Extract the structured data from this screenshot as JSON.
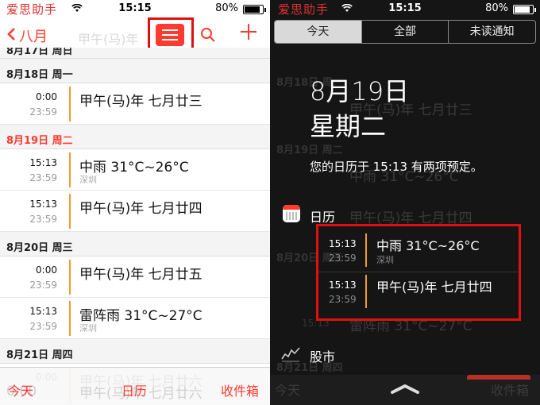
{
  "watermark": "爱思助手",
  "status": {
    "time": "15:15",
    "battery": "80%"
  },
  "left": {
    "nav": {
      "back_label": "八月",
      "ghost_title": "甲午(马)年"
    },
    "partial_top_header": "8月17日 周日",
    "sections": [
      {
        "header": "8月18日 周一",
        "highlight": false,
        "events": [
          {
            "start": "0:00",
            "end": "23:59",
            "title": "甲午(马)年 七月廿三",
            "sub": ""
          }
        ]
      },
      {
        "header": "8月19日 周二",
        "highlight": true,
        "events": [
          {
            "start": "15:13",
            "end": "23:59",
            "title": "中雨 31°C~26°C",
            "sub": "深圳"
          },
          {
            "start": "15:13",
            "end": "23:59",
            "title": "甲午(马)年 七月廿四",
            "sub": ""
          }
        ]
      },
      {
        "header": "8月20日 周三",
        "highlight": false,
        "events": [
          {
            "start": "0:00",
            "end": "23:59",
            "title": "甲午(马)年 七月廿五",
            "sub": ""
          },
          {
            "start": "15:13",
            "end": "23:59",
            "title": "雷阵雨 31°C~27°C",
            "sub": "深圳"
          }
        ]
      },
      {
        "header": "8月21日 周四",
        "highlight": false,
        "events": [
          {
            "start": "0:00",
            "end": "",
            "title": "甲午(马)年 七月廿六",
            "sub": ""
          }
        ]
      }
    ],
    "tabbar": {
      "today": "今天",
      "calendars": "日历",
      "inbox": "收件箱"
    }
  },
  "right": {
    "segments": [
      "今天",
      "全部",
      "未读通知"
    ],
    "active_segment": 0,
    "date": "8月19日",
    "weekday": "星期二",
    "summary": "您的日历于 15:13 有两项预定。",
    "calendar_label": "日历",
    "events": [
      {
        "start": "15:13",
        "end": "23:59",
        "title": "中雨 31°C~26°C",
        "sub": "深圳"
      },
      {
        "start": "15:13",
        "end": "23:59",
        "title": "甲午(马)年 七月廿四",
        "sub": ""
      }
    ],
    "stocks_label": "股市",
    "bottom": {
      "today": "今天",
      "inbox": "收件箱"
    }
  },
  "colors": {
    "accent": "#ff3b30",
    "event_bar": "#f29b2a",
    "annotation": "#e01010"
  }
}
